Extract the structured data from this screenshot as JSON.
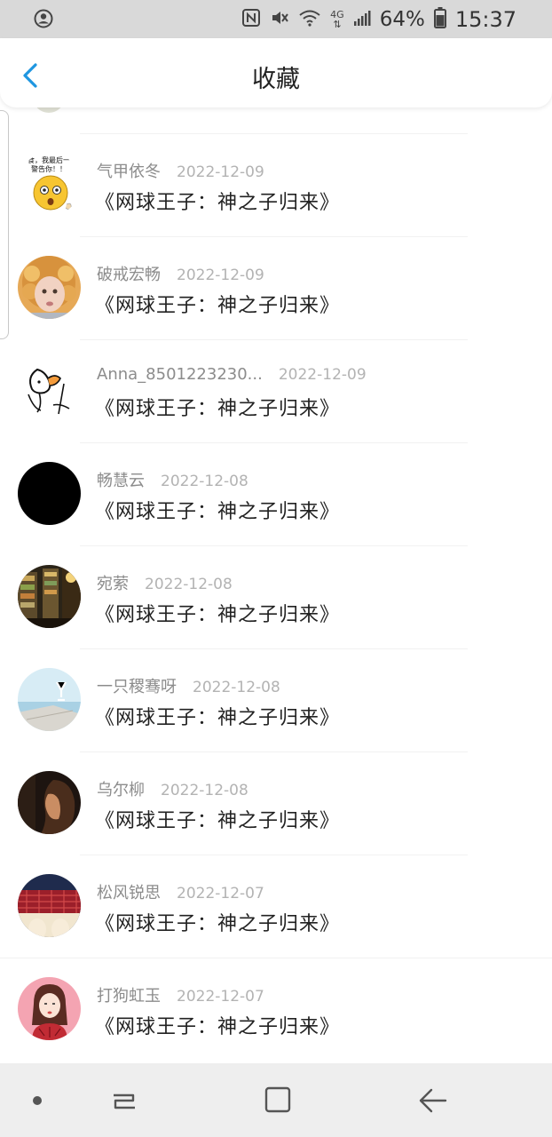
{
  "status_bar": {
    "battery_percent": "64%",
    "time": "15:37",
    "icons": [
      "account-circle-icon",
      "nfc-icon",
      "mute-icon",
      "wifi-icon",
      "4g-icon",
      "signal-icon",
      "battery-icon"
    ]
  },
  "header": {
    "back_icon": "chevron-left-icon",
    "title": "收藏"
  },
  "items": [
    {
      "username": "气甲依冬",
      "date": "2022-12-09",
      "title": "《网球王子：神之子归来》"
    },
    {
      "username": "破戒宏畅",
      "date": "2022-12-09",
      "title": "《网球王子：神之子归来》"
    },
    {
      "username": "Anna_8501223230...",
      "date": "2022-12-09",
      "title": "《网球王子：神之子归来》"
    },
    {
      "username": "畅慧云",
      "date": "2022-12-08",
      "title": "《网球王子：神之子归来》"
    },
    {
      "username": "宛萦",
      "date": "2022-12-08",
      "title": "《网球王子：神之子归来》"
    },
    {
      "username": "一只稷骞呀",
      "date": "2022-12-08",
      "title": "《网球王子：神之子归来》"
    },
    {
      "username": "乌尔柳",
      "date": "2022-12-08",
      "title": "《网球王子：神之子归来》"
    },
    {
      "username": "松风锐思",
      "date": "2022-12-07",
      "title": "《网球王子：神之子归来》"
    },
    {
      "username": "打狗虹玉",
      "date": "2022-12-07",
      "title": "《网球王子：神之子归来》"
    }
  ],
  "meme_avatar_text": [
    "食，我最后一",
    "警告你！！"
  ],
  "nav_bar": {
    "icons": [
      "dot-icon",
      "recent-apps-icon",
      "home-icon",
      "back-arrow-icon"
    ]
  },
  "colors": {
    "accent": "#1e96e0",
    "status_bar_bg": "#d9d9d9",
    "nav_bar_bg": "#eeeeee",
    "username": "#8c8c8c",
    "date": "#b3b3b3"
  }
}
